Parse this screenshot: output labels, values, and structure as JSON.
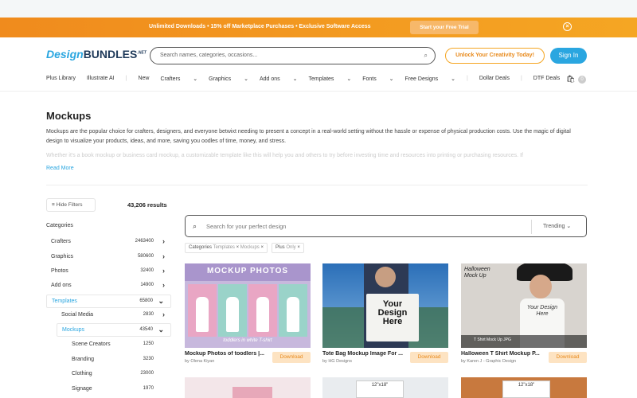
{
  "promo": {
    "message": "Unlimited Downloads  •  15% off Marketplace Purchases  •  Exclusive Software Access",
    "trial_label": "Start your Free Trial",
    "close_icon": "×"
  },
  "header": {
    "logo_design": "Design",
    "logo_bundles": "BUNDLES",
    "logo_net": ".NET",
    "search_placeholder": "Search names, categories, occasions...",
    "unlock_label": "Unlock Your Creativity Today!",
    "signin_label": "Sign In",
    "cart_count": "0"
  },
  "nav": {
    "items": [
      "Plus Library",
      "Illustrate AI",
      "New",
      "Crafters",
      "Graphics",
      "Add ons",
      "Templates",
      "Fonts",
      "Free Designs",
      "Dollar Deals",
      "DTF Deals"
    ]
  },
  "page": {
    "title": "Mockups",
    "description": "Mockups are the popular choice for crafters, designers, and everyone betwixt needing to present a concept in a real-world setting without the hassle or expense of physical production costs. Use the magic of digital design to visualize your products, ideas, and more, saving you oodles of time, money, and stress.",
    "description2": "Whether it's a book mockup or business card mockup, a customizable template like this will help you and others to try before investing time and resources into printing or purchasing resources. If",
    "read_more": "Read More"
  },
  "filters": {
    "hide_label": "Hide Filters",
    "results": "43,206 results",
    "categories_label": "Categories",
    "categories": [
      {
        "label": "Crafters",
        "count": "2463400",
        "arrow": "›"
      },
      {
        "label": "Graphics",
        "count": "580600",
        "arrow": "›"
      },
      {
        "label": "Photos",
        "count": "32400",
        "arrow": "›"
      },
      {
        "label": "Add ons",
        "count": "14900",
        "arrow": "›"
      },
      {
        "label": "Templates",
        "count": "65800",
        "arrow": "⌄"
      },
      {
        "label": "Social Media",
        "count": "2830",
        "arrow": "›"
      },
      {
        "label": "Mockups",
        "count": "43540",
        "arrow": "⌄"
      },
      {
        "label": "Scene Creators",
        "count": "1250",
        "arrow": ""
      },
      {
        "label": "Branding",
        "count": "3230",
        "arrow": ""
      },
      {
        "label": "Clothing",
        "count": "23000",
        "arrow": ""
      },
      {
        "label": "Signage",
        "count": "1970",
        "arrow": ""
      }
    ]
  },
  "results": {
    "search_placeholder": "Search for your perfect design",
    "sort": "Trending",
    "chips": [
      {
        "label": "Categories",
        "value": "Templates",
        "extra": "Mockups"
      },
      {
        "label": "Plus",
        "value": "Only"
      }
    ],
    "products": [
      {
        "name": "Mockup Photos of toodlers |...",
        "by": "by Olena Kiyan",
        "download": "Download",
        "img_title": "MOCKUP PHOTOS",
        "img_sub": "toddlers in white T-shirt"
      },
      {
        "name": "Tote Bag Mockup Image For ...",
        "by": "by HG Designs",
        "download": "Download",
        "img_text": "Your Design Here"
      },
      {
        "name": "Halloween T Shirt Mockup P...",
        "by": "by Karen J - Graphic Design",
        "download": "Download",
        "img_title": "Halloween Mock Up",
        "img_text": "Your Design Here",
        "img_tag": "T Shirt Mock Up JPG"
      }
    ],
    "next_labels": [
      "12\"x18\"",
      "12\"x18\""
    ]
  }
}
